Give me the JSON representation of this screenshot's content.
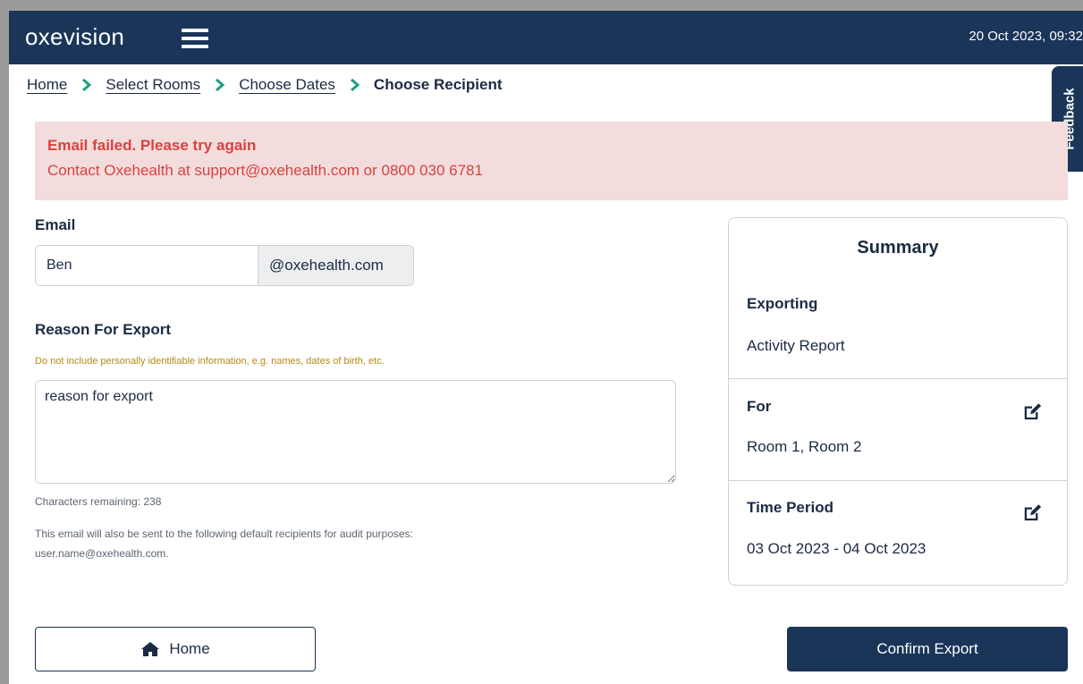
{
  "header": {
    "logo": "oxevision",
    "datetime": "20 Oct 2023, 09:32"
  },
  "breadcrumb": {
    "items": [
      "Home",
      "Select Rooms",
      "Choose Dates"
    ],
    "current": "Choose Recipient"
  },
  "feedback_tab": "Feedback",
  "alert": {
    "title": "Email failed. Please try again",
    "message": "Contact Oxehealth at support@oxehealth.com or 0800 030 6781"
  },
  "form": {
    "email_label": "Email",
    "email_value": "Ben",
    "email_suffix": "@oxehealth.com",
    "reason_label": "Reason For Export",
    "reason_warning": "Do not include personally identifiable information, e.g. names, dates of birth, etc.",
    "reason_value": "reason for export",
    "chars_remaining": "Characters remaining: 238",
    "audit_note_line1": "This email will also be sent to the following default recipients for audit purposes:",
    "audit_note_line2": "user.name@oxehealth.com."
  },
  "summary": {
    "title": "Summary",
    "exporting_label": "Exporting",
    "exporting_value": "Activity Report",
    "for_label": "For",
    "for_value": "Room 1, Room 2",
    "period_label": "Time Period",
    "period_value": "03 Oct 2023 - 04 Oct 2023"
  },
  "buttons": {
    "home": "Home",
    "confirm": "Confirm Export"
  },
  "icons": {
    "menu": "hamburger-menu-icon",
    "breadcrumb_separator": "chevron-right-icon",
    "edit": "edit-icon",
    "home": "home-icon"
  },
  "colors": {
    "primary": "#1a3558",
    "accent": "#1e9e7e",
    "error_text": "#d9433f",
    "error_bg": "#f2dcdc",
    "warning": "#b58a10"
  }
}
